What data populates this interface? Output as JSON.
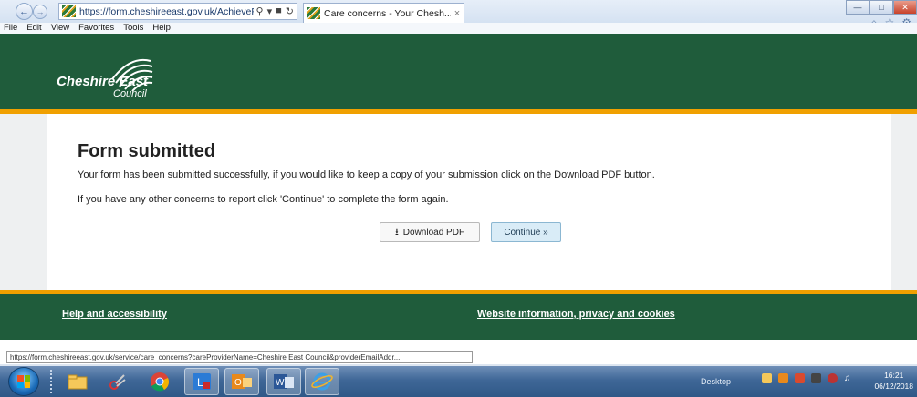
{
  "browser": {
    "url": "https://form.cheshireeast.gov.uk/AchieveFo",
    "tab_title": "Care concerns - Your Chesh...",
    "tab_close": "×",
    "menu": [
      "File",
      "Edit",
      "View",
      "Favorites",
      "Tools",
      "Help"
    ],
    "status_url": "https://form.cheshireeast.gov.uk/service/care_concerns?careProviderName=Cheshire East Council&providerEmailAddr..."
  },
  "header": {
    "logo_name": "Cheshire East",
    "logo_sub": "Council"
  },
  "main": {
    "title": "Form submitted",
    "message_1": "Your form has been submitted successfully, if you would like to keep a copy of your submission click on the Download PDF button.",
    "message_2": "If you have any other concerns to report click 'Continue' to complete the form again.",
    "download_label": "Download PDF",
    "continue_label": "Continue »"
  },
  "footer": {
    "link_1": "Help and accessibility",
    "link_2": "Website information, privacy and cookies"
  },
  "taskbar": {
    "desktop_label": "Desktop",
    "time": "16:21",
    "date": "06/12/2018",
    "apps": [
      "explorer-icon",
      "snipping-tool-icon",
      "chrome-icon",
      "lync-icon",
      "outlook-icon",
      "word-icon",
      "internet-explorer-icon"
    ]
  },
  "colors": {
    "brand_green": "#1f5c3b",
    "accent_orange": "#f0a000",
    "continue_bg": "#d9ecf7"
  }
}
